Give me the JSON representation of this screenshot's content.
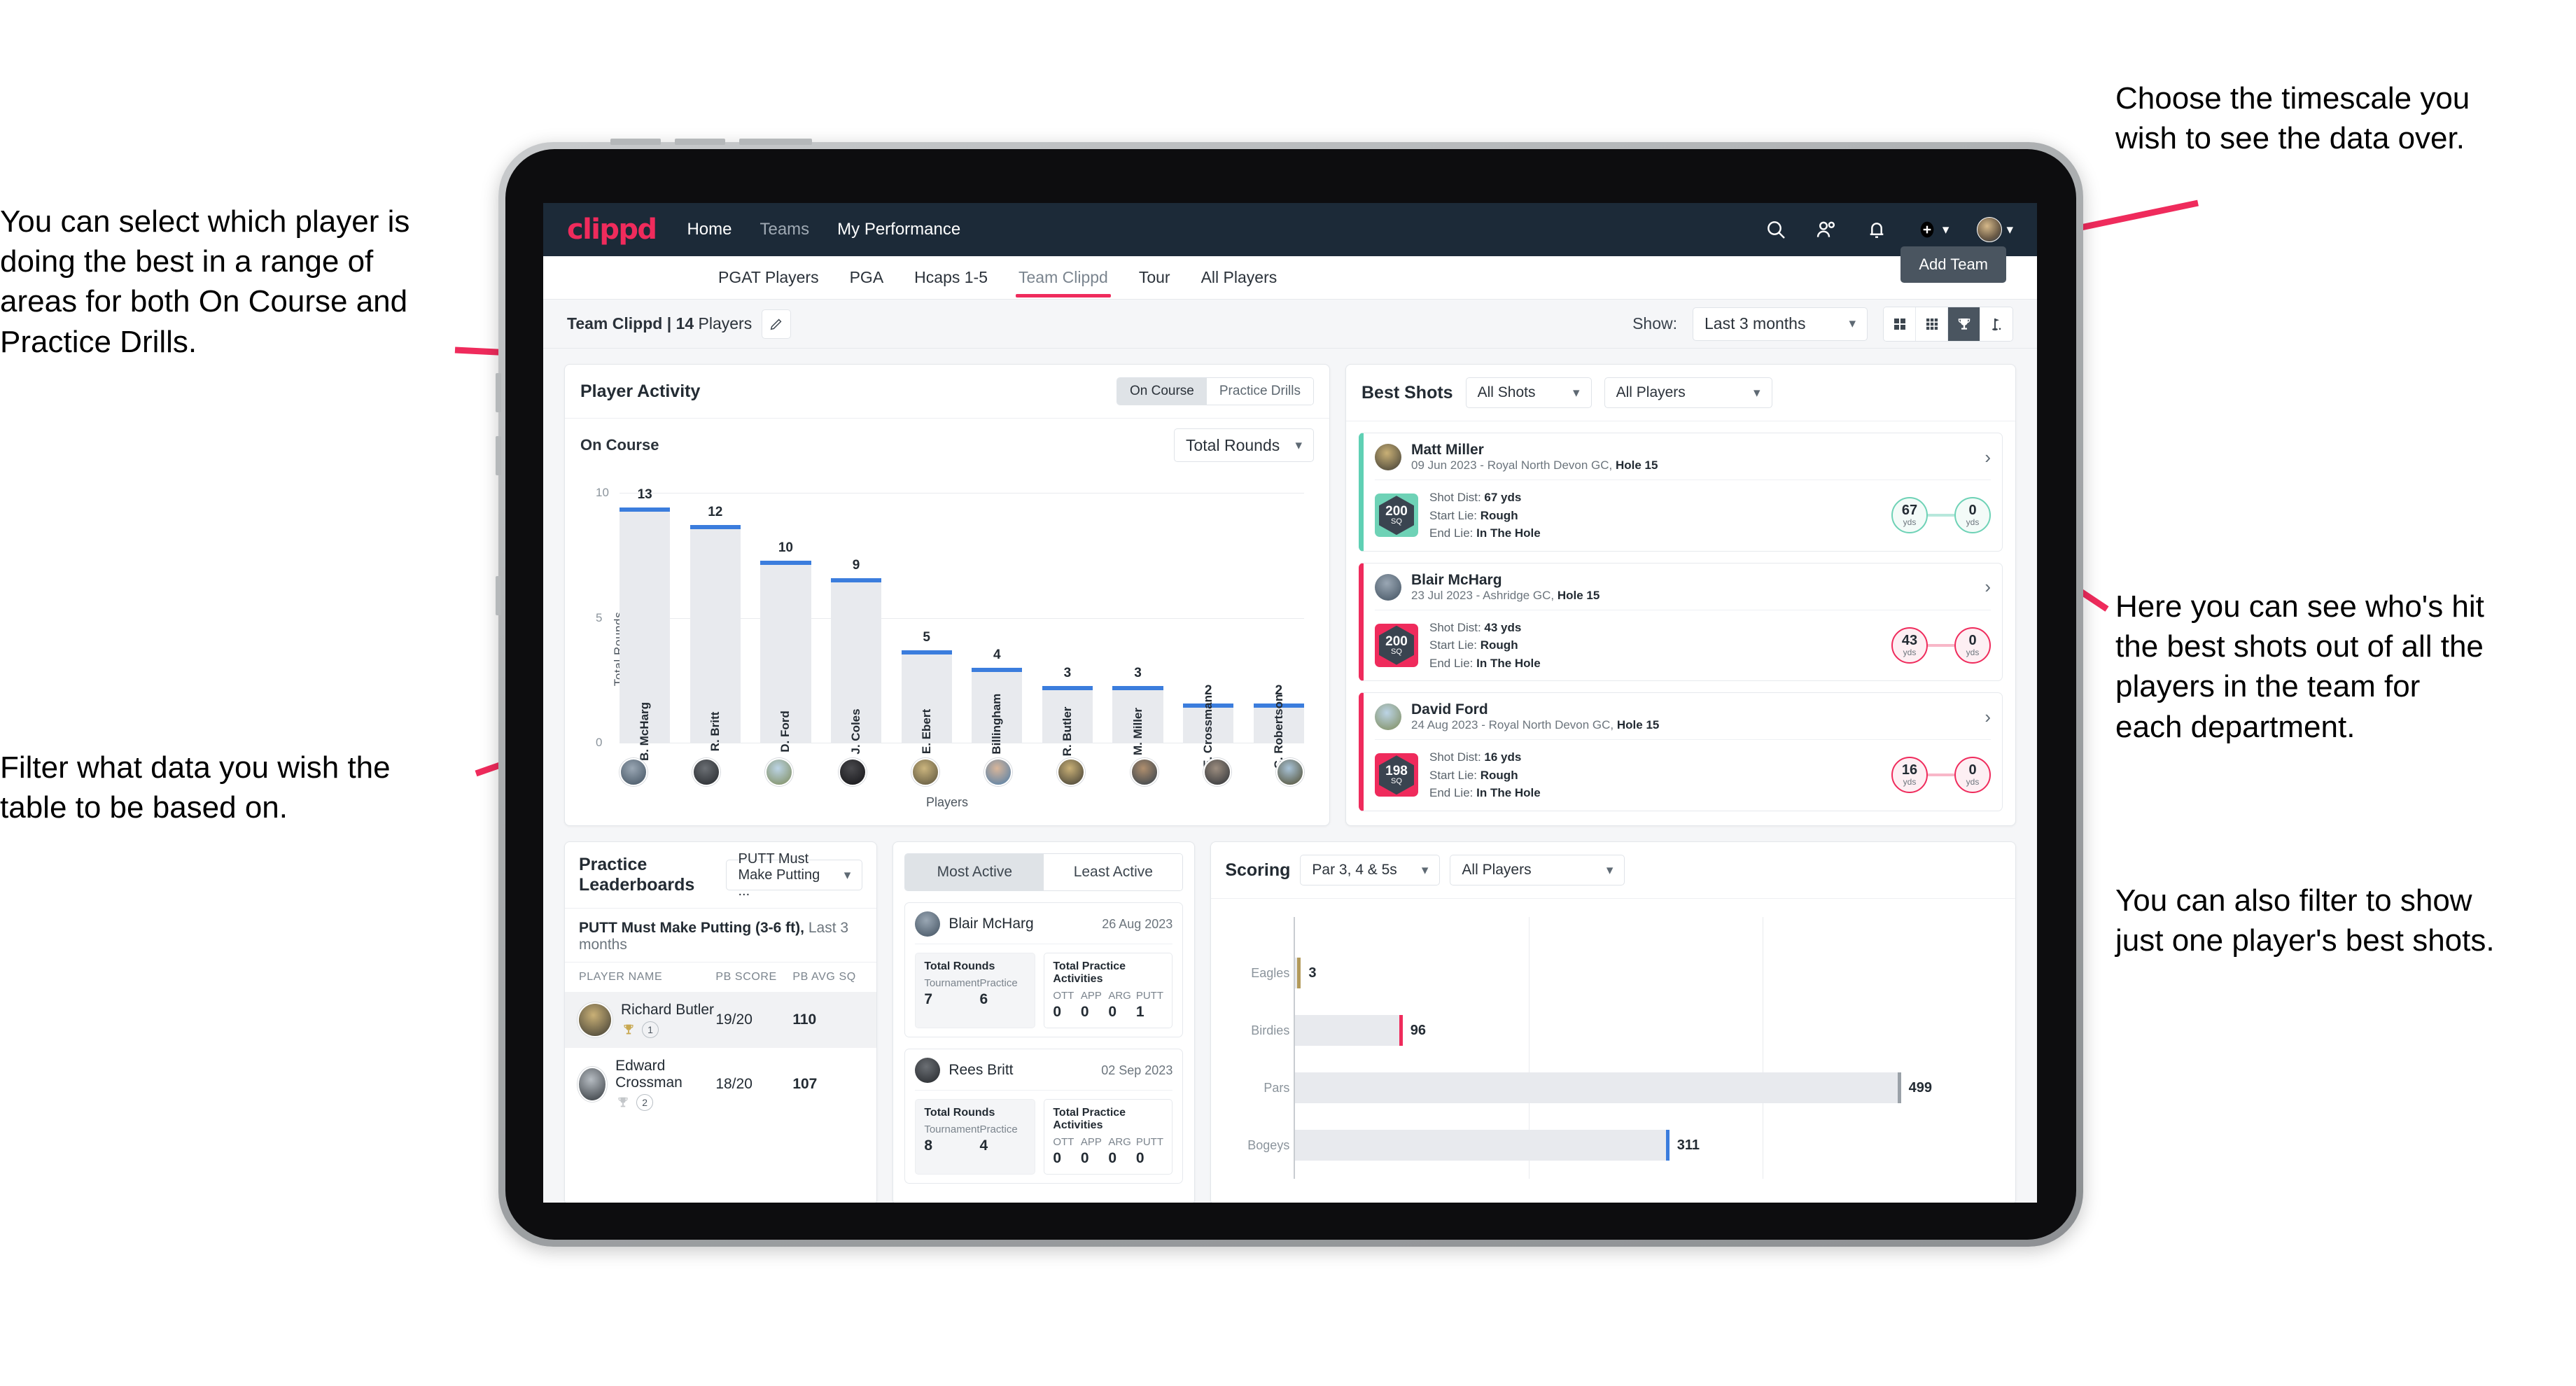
{
  "annotations": {
    "left_top": "You can select which player is\ndoing the best in a range of\nareas for both On Course and\nPractice Drills.",
    "left_bottom": "Filter what data you wish the\ntable to be based on.",
    "right_top": "Choose the timescale you\nwish to see the data over.",
    "right_middle": "Here you can see who's hit\nthe best shots out of all the\nplayers in the team for\neach department.",
    "right_bottom": "You can also filter to show\njust one player's best shots."
  },
  "topbar": {
    "logo": "clippd",
    "links": [
      {
        "label": "Home",
        "dim": false
      },
      {
        "label": "Teams",
        "dim": true
      },
      {
        "label": "My Performance",
        "dim": false
      }
    ],
    "icons": [
      "search-icon",
      "people-icon",
      "bell-icon",
      "plus-circle-icon",
      "avatar"
    ]
  },
  "tabs": {
    "items": [
      "PGAT Players",
      "PGA",
      "Hcaps 1-5",
      "Team Clippd",
      "Tour",
      "All Players"
    ],
    "active_index": 3,
    "add_team_label": "Add Team"
  },
  "subbar": {
    "team_name": "Team Clippd",
    "team_separator": " | ",
    "player_count": "14",
    "players_word": " Players",
    "show_label": "Show:",
    "timescale_value": "Last 3 months",
    "view_icons": [
      "grid-2x2-icon",
      "grid-3x3-icon",
      "trophy-icon",
      "golf-flag-icon"
    ],
    "active_view_index": 2
  },
  "player_activity": {
    "title": "Player Activity",
    "segments": [
      "On Course",
      "Practice Drills"
    ],
    "active_segment": 0,
    "subtitle": "On Course",
    "metric_value": "Total Rounds"
  },
  "chart_data": [
    {
      "type": "bar",
      "title": "Player Activity - On Course",
      "xlabel": "Players",
      "ylabel": "Total Rounds",
      "categories": [
        "B. McHarg",
        "R. Britt",
        "D. Ford",
        "J. Coles",
        "E. Ebert",
        "D. Billingham",
        "R. Butler",
        "M. Miller",
        "E. Crossman",
        "C. Robertson"
      ],
      "values": [
        13,
        12,
        10,
        9,
        5,
        4,
        3,
        3,
        2,
        2
      ],
      "ylim": [
        0,
        14
      ],
      "yticks": [
        0,
        5,
        10
      ],
      "grid": true,
      "bar_color": "#e8eaee",
      "cap_color": "#3b7ddd"
    },
    {
      "type": "bar",
      "orientation": "horizontal",
      "title": "Scoring",
      "categories": [
        "Eagles",
        "Birdies",
        "Pars",
        "Bogeys"
      ],
      "values": [
        3,
        96,
        499,
        311
      ],
      "bar_colors": [
        "#b39a5b",
        "#ef2b5c",
        "#9aa1a8",
        "#3b7ddd"
      ],
      "xlim": [
        0,
        640
      ],
      "grid": true
    }
  ],
  "best_shots": {
    "title": "Best Shots",
    "shot_filter": "All Shots",
    "player_filter": "All Players",
    "shots": [
      {
        "player": "Matt Miller",
        "meta_plain": "09 Jun 2023 - Royal North Devon GC, ",
        "meta_bold": "Hole 15",
        "accent": "teal",
        "hex_value": "200",
        "hex_unit": "SQ",
        "shot_dist_label": "Shot Dist: ",
        "shot_dist_value": "67 yds",
        "start_lie_label": "Start Lie: ",
        "start_lie_value": "Rough",
        "end_lie_label": "End Lie: ",
        "end_lie_value": "In The Hole",
        "from_value": "67",
        "from_unit": "yds",
        "to_value": "0",
        "to_unit": "yds"
      },
      {
        "player": "Blair McHarg",
        "meta_plain": "23 Jul 2023 - Ashridge GC, ",
        "meta_bold": "Hole 15",
        "accent": "pink",
        "hex_value": "200",
        "hex_unit": "SQ",
        "shot_dist_label": "Shot Dist: ",
        "shot_dist_value": "43 yds",
        "start_lie_label": "Start Lie: ",
        "start_lie_value": "Rough",
        "end_lie_label": "End Lie: ",
        "end_lie_value": "In The Hole",
        "from_value": "43",
        "from_unit": "yds",
        "to_value": "0",
        "to_unit": "yds"
      },
      {
        "player": "David Ford",
        "meta_plain": "24 Aug 2023 - Royal North Devon GC, ",
        "meta_bold": "Hole 15",
        "accent": "pink",
        "hex_value": "198",
        "hex_unit": "SQ",
        "shot_dist_label": "Shot Dist: ",
        "shot_dist_value": "16 yds",
        "start_lie_label": "Start Lie: ",
        "start_lie_value": "Rough",
        "end_lie_label": "End Lie: ",
        "end_lie_value": "In The Hole",
        "from_value": "16",
        "from_unit": "yds",
        "to_value": "0",
        "to_unit": "yds"
      }
    ]
  },
  "practice_leaderboards": {
    "title": "Practice Leaderboards",
    "drill_filter": "PUTT Must Make Putting ...",
    "subtitle_bold": "PUTT Must Make Putting (3-6 ft),",
    "subtitle_plain": " Last 3 months",
    "columns": [
      "PLAYER NAME",
      "PB SCORE",
      "PB AVG SQ"
    ],
    "rows": [
      {
        "name": "Richard Butler",
        "rank": "1",
        "trophy": "gold",
        "pb_score": "19/20",
        "pb_avg_sq": "110",
        "highlight": true
      },
      {
        "name": "Edward Crossman",
        "rank": "2",
        "trophy": "silver",
        "pb_score": "18/20",
        "pb_avg_sq": "107",
        "highlight": false
      }
    ]
  },
  "activity": {
    "tabs": [
      "Most Active",
      "Least Active"
    ],
    "active_tab": 0,
    "cards": [
      {
        "name": "Blair McHarg",
        "date": "26 Aug 2023",
        "rounds_title": "Total Rounds",
        "rounds": [
          {
            "key": "Tournament",
            "value": "7"
          },
          {
            "key": "Practice",
            "value": "6"
          }
        ],
        "practice_title": "Total Practice Activities",
        "practice": [
          {
            "key": "OTT",
            "value": "0"
          },
          {
            "key": "APP",
            "value": "0"
          },
          {
            "key": "ARG",
            "value": "0"
          },
          {
            "key": "PUTT",
            "value": "1"
          }
        ]
      },
      {
        "name": "Rees Britt",
        "date": "02 Sep 2023",
        "rounds_title": "Total Rounds",
        "rounds": [
          {
            "key": "Tournament",
            "value": "8"
          },
          {
            "key": "Practice",
            "value": "4"
          }
        ],
        "practice_title": "Total Practice Activities",
        "practice": [
          {
            "key": "OTT",
            "value": "0"
          },
          {
            "key": "APP",
            "value": "0"
          },
          {
            "key": "ARG",
            "value": "0"
          },
          {
            "key": "PUTT",
            "value": "0"
          }
        ]
      }
    ]
  },
  "scoring": {
    "title": "Scoring",
    "par_filter": "Par 3, 4 & 5s",
    "player_filter": "All Players",
    "rows": [
      {
        "label": "Eagles",
        "value": "3",
        "color": "#b39a5b"
      },
      {
        "label": "Birdies",
        "value": "96",
        "color": "#ef2b5c"
      },
      {
        "label": "Pars",
        "value": "499",
        "color": "#9aa1a8"
      },
      {
        "label": "Bogeys",
        "value": "311",
        "color": "#3b7ddd"
      }
    ]
  },
  "colors": {
    "accent": "#ef2b5c",
    "navy": "#1c2a38",
    "teal": "#6ed2b6",
    "blue": "#3b7ddd"
  }
}
